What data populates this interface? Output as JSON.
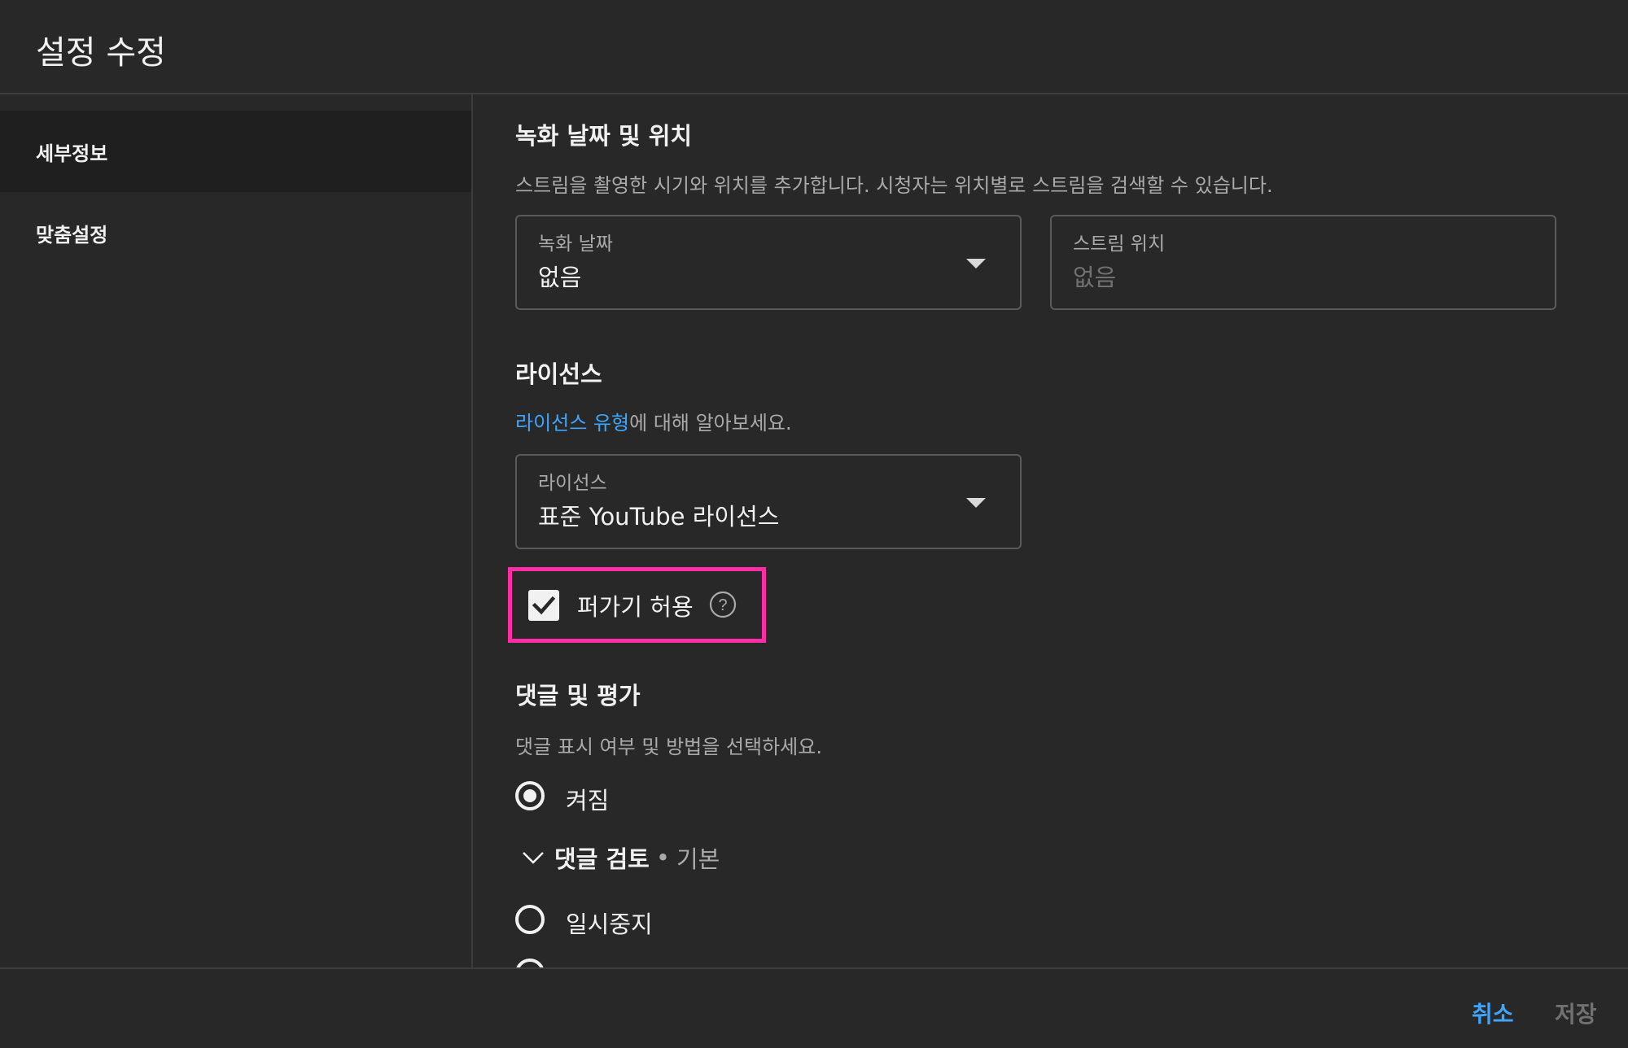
{
  "header": {
    "title": "설정 수정"
  },
  "sidebar": {
    "items": [
      {
        "label": "세부정보"
      },
      {
        "label": "맞춤설정"
      }
    ]
  },
  "recording": {
    "title": "녹화 날짜 및 위치",
    "description": "스트림을 촬영한 시기와 위치를 추가합니다. 시청자는 위치별로 스트림을 검색할 수 있습니다.",
    "date_field": {
      "label": "녹화 날짜",
      "value": "없음"
    },
    "location_field": {
      "label": "스트림 위치",
      "placeholder": "없음"
    }
  },
  "license": {
    "title": "라이선스",
    "link_text": "라이선스 유형",
    "description_suffix": "에 대해 알아보세요.",
    "field": {
      "label": "라이선스",
      "value": "표준 YouTube 라이선스"
    },
    "embed_checkbox": {
      "label": "퍼가기 허용",
      "checked": true
    }
  },
  "comments": {
    "title": "댓글 및 평가",
    "description": "댓글 표시 여부 및 방법을 선택하세요.",
    "options": [
      {
        "label": "켜짐",
        "selected": true
      },
      {
        "label": "일시중지",
        "selected": false
      }
    ],
    "review": {
      "title": "댓글 검토",
      "separator": "•",
      "value": "기본"
    }
  },
  "footer": {
    "cancel_label": "취소",
    "save_label": "저장"
  },
  "colors": {
    "accent": "#3ea6ff",
    "highlight": "#ff2ea6",
    "background": "#282828"
  }
}
